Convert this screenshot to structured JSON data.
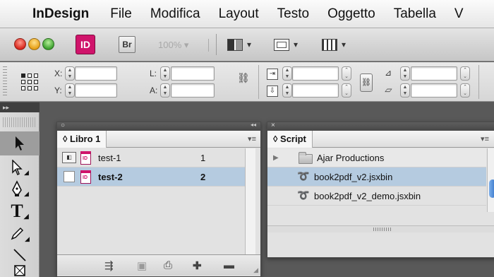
{
  "menubar": {
    "apple_icon": "apple-icon",
    "items": [
      "InDesign",
      "File",
      "Modifica",
      "Layout",
      "Testo",
      "Oggetto",
      "Tabella",
      "V"
    ]
  },
  "appbar": {
    "app_badge": "ID",
    "bridge_badge": "Br",
    "zoom": "100%",
    "zoom_arrow": "▾",
    "tool_arrow": "▾"
  },
  "control": {
    "x_label": "X:",
    "y_label": "Y:",
    "l_label": "L:",
    "a_label": "A:",
    "angle_label": "⊿"
  },
  "toolbox": {
    "collapse": "▸▸",
    "tools": [
      "selection-tool",
      "direct-selection-tool",
      "pen-tool",
      "type-tool",
      "pencil-tool",
      "line-tool",
      "rectangle-frame-tool"
    ]
  },
  "book_panel": {
    "collapse": "◂◂",
    "tab_label": "◊ Libro 1",
    "menu_icon": "▾≡",
    "rows": [
      {
        "name": "test-1",
        "pages": "1",
        "selected": false
      },
      {
        "name": "test-2",
        "pages": "2",
        "selected": true
      }
    ]
  },
  "script_panel": {
    "close": "×",
    "tab_label": "◊ Script",
    "menu_icon": "▾≡",
    "items": [
      {
        "name": "Ajar Productions",
        "type": "folder"
      },
      {
        "name": "book2pdf_v2.jsxbin",
        "type": "script",
        "selected": true
      },
      {
        "name": "book2pdf_v2_demo.jsxbin",
        "type": "script",
        "selected": false
      }
    ]
  },
  "colors": {
    "selection": "#b5cbe0",
    "indesign_pink": "#d0146b",
    "workspace": "#595959"
  }
}
